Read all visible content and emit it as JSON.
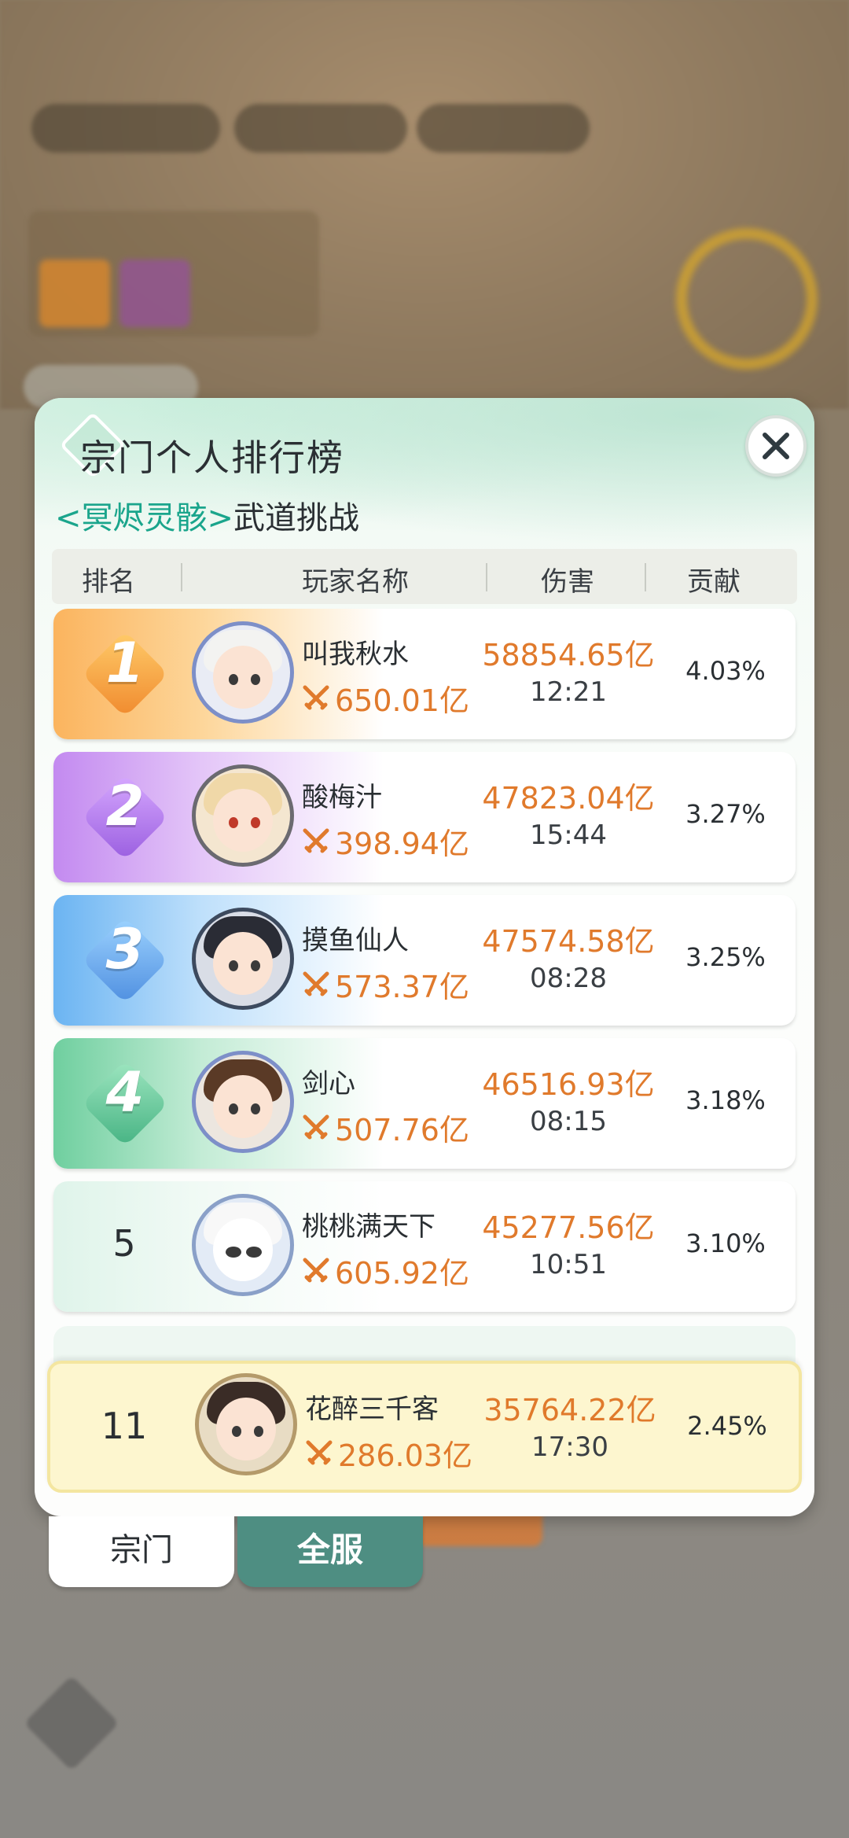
{
  "panel": {
    "title": "宗门个人排行榜",
    "subtitle_boss": "<冥烬灵骸>",
    "subtitle_mode": "武道挑战"
  },
  "header": {
    "rank": "排名",
    "player": "玩家名称",
    "damage": "伤害",
    "contribution": "贡献"
  },
  "rows": [
    {
      "rank": "1",
      "name": "叫我秋水",
      "power": "650.01亿",
      "damage": "58854.65亿",
      "time": "12:21",
      "contribution": "4.03%"
    },
    {
      "rank": "2",
      "name": "酸梅汁",
      "power": "398.94亿",
      "damage": "47823.04亿",
      "time": "15:44",
      "contribution": "3.27%"
    },
    {
      "rank": "3",
      "name": "摸鱼仙人",
      "power": "573.37亿",
      "damage": "47574.58亿",
      "time": "08:28",
      "contribution": "3.25%"
    },
    {
      "rank": "4",
      "name": "剑心",
      "power": "507.76亿",
      "damage": "46516.93亿",
      "time": "08:15",
      "contribution": "3.18%"
    },
    {
      "rank": "5",
      "name": "桃桃满天下",
      "power": "605.92亿",
      "damage": "45277.56亿",
      "time": "10:51",
      "contribution": "3.10%"
    }
  ],
  "self": {
    "rank": "11",
    "name": "花醉三千客",
    "power": "286.03亿",
    "damage": "35764.22亿",
    "time": "17:30",
    "contribution": "2.45%"
  },
  "tabs": {
    "sect": "宗门",
    "all_server": "全服"
  },
  "colors": {
    "accent": "#4e8e82",
    "damage": "#e07a2c",
    "boss": "#1aa58c"
  },
  "icons": {
    "close": "close-icon",
    "power": "crossed-swords-icon"
  }
}
